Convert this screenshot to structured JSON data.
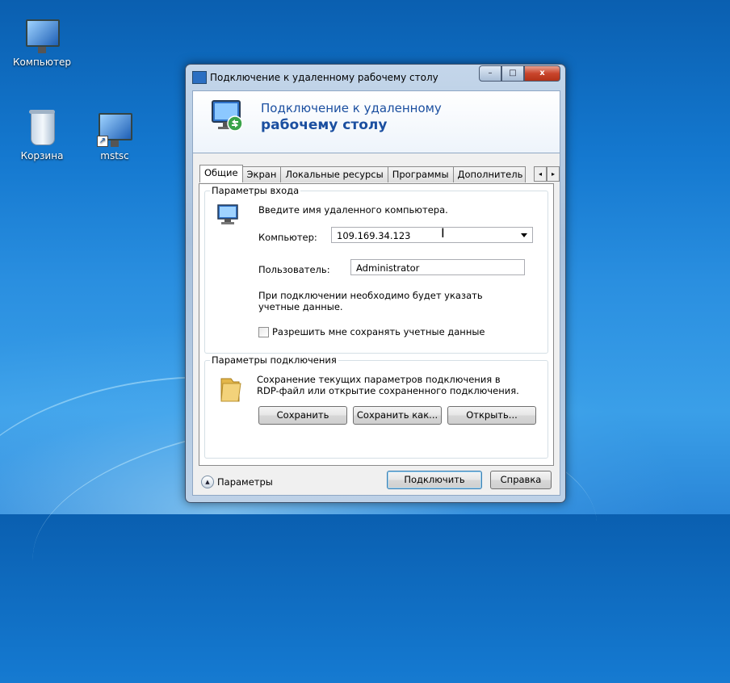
{
  "desktop": {
    "icons": [
      {
        "label": "Компьютер"
      },
      {
        "label": "Корзина"
      },
      {
        "label": "mstsc"
      }
    ]
  },
  "window": {
    "title": "Подключение к удаленному рабочему столу",
    "caption_buttons": {
      "minimize": "–",
      "maximize": "□",
      "close": "x"
    }
  },
  "header": {
    "line1": "Подключение к удаленному",
    "line2": "рабочему столу"
  },
  "tabs": [
    {
      "label": "Общие",
      "active": true
    },
    {
      "label": "Экран"
    },
    {
      "label": "Локальные ресурсы"
    },
    {
      "label": "Программы"
    },
    {
      "label": "Дополнитель"
    }
  ],
  "tab_scroll": {
    "left": "◂",
    "right": "▸"
  },
  "logon_group": {
    "title": "Параметры входа",
    "prompt": "Введите имя удаленного компьютера.",
    "computer_label": "Компьютер:",
    "computer_value": "109.169.34.123",
    "user_label": "Пользователь:",
    "user_value": "Administrator",
    "note": "При подключении необходимо будет указать учетные данные.",
    "save_credentials_label": "Разрешить мне сохранять учетные данные",
    "save_credentials_checked": false
  },
  "connection_group": {
    "title": "Параметры подключения",
    "description": "Сохранение текущих параметров подключения в RDP-файл или открытие сохраненного подключения.",
    "save_button": "Сохранить",
    "save_as_button": "Сохранить как...",
    "open_button": "Открыть..."
  },
  "footer": {
    "options_label": "Параметры",
    "connect_button": "Подключить",
    "help_button": "Справка"
  },
  "colors": {
    "accent": "#1b4fa0",
    "close": "#c9452c"
  }
}
